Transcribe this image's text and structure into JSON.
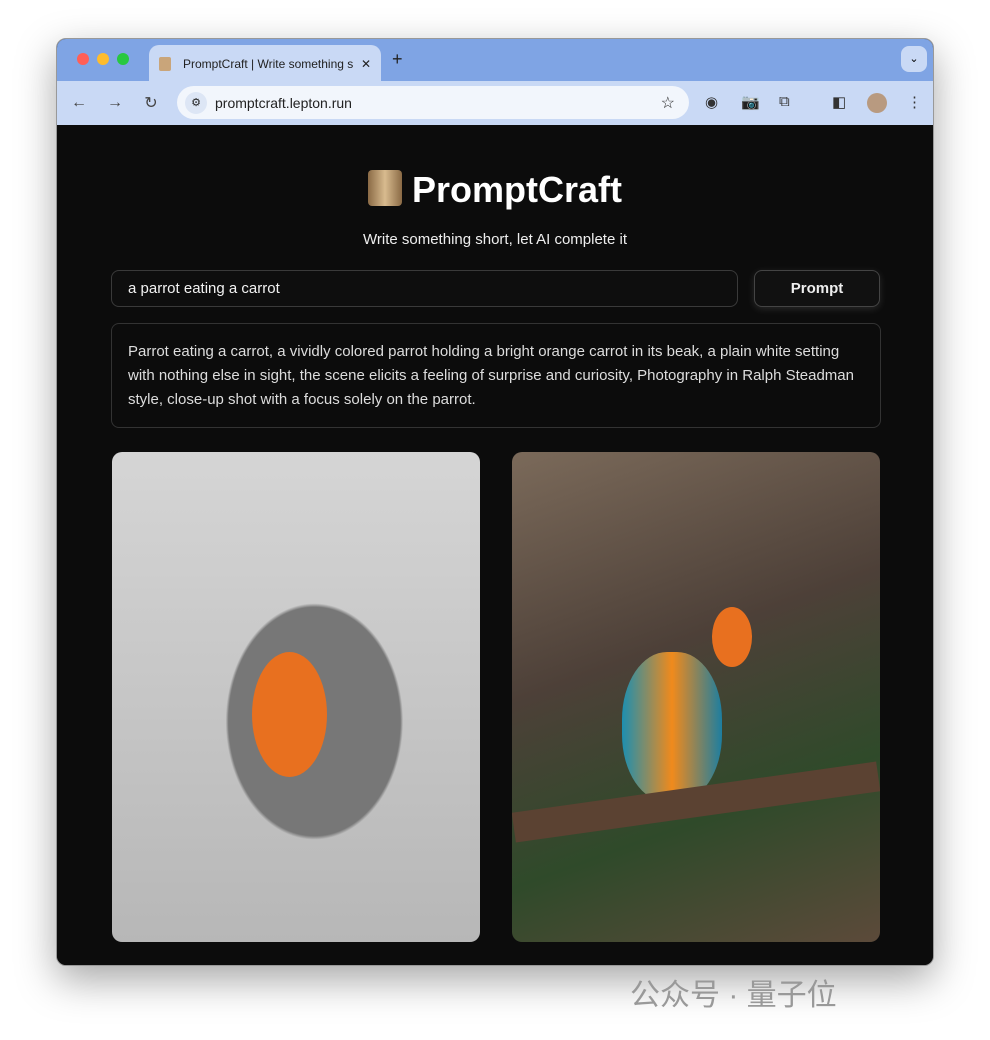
{
  "browser": {
    "tab_title": "PromptCraft | Write something short, let AI complete it",
    "url": "promptcraft.lepton.run",
    "traffic_lights": [
      "#ff5f57",
      "#febc2e",
      "#28c840"
    ]
  },
  "app": {
    "title": "PromptCraft",
    "subtitle": "Write something short, let AI complete it",
    "input_value": "a parrot eating a carrot",
    "button_label": "Prompt",
    "result": "Parrot eating a carrot, a vividly colored parrot holding a bright orange carrot in its beak, a plain white setting with nothing else in sight, the scene elicits a feeling of surprise and curiosity, Photography in Ralph Steadman style, close-up shot with a focus solely on the parrot."
  },
  "watermark": "公众号 · 量子位"
}
